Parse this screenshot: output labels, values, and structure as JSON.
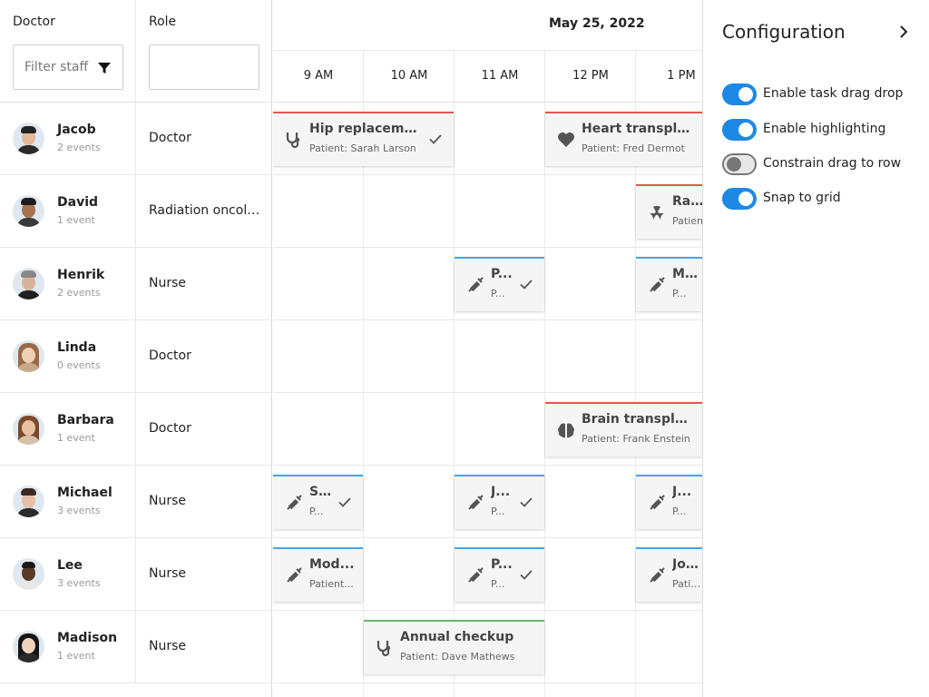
{
  "left": {
    "doctor_header": "Doctor",
    "role_header": "Role",
    "filter_placeholder": "Filter staff",
    "role_filter_value": ""
  },
  "staff": [
    {
      "name": "Jacob",
      "events": "2 events",
      "role": "Doctor"
    },
    {
      "name": "David",
      "events": "1 event",
      "role": "Radiation oncologist"
    },
    {
      "name": "Henrik",
      "events": "2 events",
      "role": "Nurse"
    },
    {
      "name": "Linda",
      "events": "0 events",
      "role": "Doctor"
    },
    {
      "name": "Barbara",
      "events": "1 event",
      "role": "Doctor"
    },
    {
      "name": "Michael",
      "events": "3 events",
      "role": "Nurse"
    },
    {
      "name": "Lee",
      "events": "3 events",
      "role": "Nurse"
    },
    {
      "name": "Madison",
      "events": "1 event",
      "role": "Nurse"
    }
  ],
  "schedule": {
    "date": "May 25, 2022",
    "hours": [
      "9 AM",
      "10 AM",
      "11 AM",
      "12 PM",
      "1 PM"
    ]
  },
  "events": [
    {
      "title": "Hip replacement",
      "patient": "Patient: Sarah Larson",
      "icon": "stethoscope-icon",
      "color": "#e05a4e",
      "done": true
    },
    {
      "title": "Heart transplant",
      "patient": "Patient: Fred Dermot",
      "icon": "heart-icon",
      "color": "#e05a4e",
      "done": false
    },
    {
      "title": "Radiation therapy",
      "patient": "Patient",
      "icon": "radiation-icon",
      "color": "#e05a4e",
      "done": false
    },
    {
      "title": "P...",
      "patient": "P...",
      "icon": "syringe-icon",
      "color": "#42a5f5",
      "done": true
    },
    {
      "title": "M...",
      "patient": "P...",
      "icon": "syringe-icon",
      "color": "#42a5f5",
      "done": false
    },
    {
      "title": "Brain transplant",
      "patient": "Patient: Frank Enstein",
      "icon": "brain-icon",
      "color": "#e05a4e",
      "done": false
    },
    {
      "title": "S...",
      "patient": "P...",
      "icon": "syringe-icon",
      "color": "#42a5f5",
      "done": true
    },
    {
      "title": "J...",
      "patient": "P...",
      "icon": "syringe-icon",
      "color": "#42a5f5",
      "done": true
    },
    {
      "title": "J...",
      "patient": "P...",
      "icon": "syringe-icon",
      "color": "#42a5f5",
      "done": false
    },
    {
      "title": "Mod...",
      "patient": "Patient...",
      "icon": "syringe-icon",
      "color": "#42a5f5",
      "done": false
    },
    {
      "title": "P...",
      "patient": "P...",
      "icon": "syringe-icon",
      "color": "#42a5f5",
      "done": true
    },
    {
      "title": "Joh...",
      "patient": "Patient",
      "icon": "syringe-icon",
      "color": "#42a5f5",
      "done": false
    },
    {
      "title": "Annual checkup",
      "patient": "Patient: Dave Mathews",
      "icon": "stethoscope-icon",
      "color": "#66bb6a",
      "done": false
    }
  ],
  "config": {
    "title": "Configuration",
    "options": [
      {
        "label": "Enable task drag drop",
        "on": true
      },
      {
        "label": "Enable highlighting",
        "on": true
      },
      {
        "label": "Constrain drag to row",
        "on": false
      },
      {
        "label": "Snap to grid",
        "on": true
      }
    ]
  },
  "colors": {
    "accent": "#1e88e5",
    "surgery": "#e05a4e",
    "nursing": "#42a5f5",
    "checkup": "#66bb6a"
  }
}
